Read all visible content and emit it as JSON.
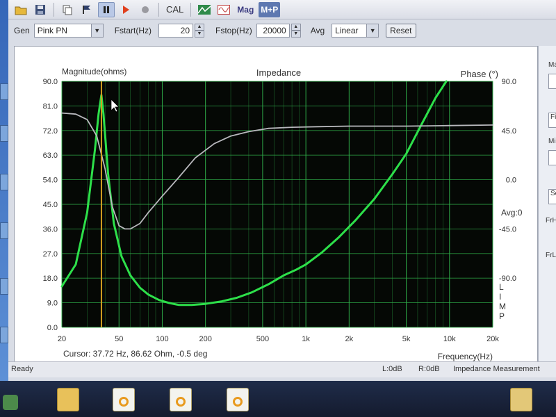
{
  "toolbar": {
    "cal_label": "CAL",
    "mag_label": "Mag",
    "mp_label": "M+P"
  },
  "controls": {
    "gen_label": "Gen",
    "gen_value": "Pink PN",
    "fstart_label": "Fstart(Hz)",
    "fstart_value": "20",
    "fstop_label": "Fstop(Hz)",
    "fstop_value": "20000",
    "avg_label": "Avg",
    "avg_value": "Linear",
    "reset_label": "Reset"
  },
  "right_panel": {
    "ma": "Ma",
    "fi": "Fil",
    "mi": "Min",
    "se": "Set",
    "frhi": "FrHi",
    "frlo": "FrLo"
  },
  "status": {
    "ready": "Ready",
    "left": "L:0dB",
    "right": "R:0dB",
    "mode": "Impedance Measurement"
  },
  "chart_data": {
    "type": "line",
    "title": "Impedance",
    "ylabel": "Magnitude(ohms)",
    "y2label": "Phase (°)",
    "xlabel": "Frequency(Hz)",
    "x_scale": "log",
    "xlim": [
      20,
      20000
    ],
    "ylim": [
      0,
      90
    ],
    "y2lim": [
      -135,
      90
    ],
    "x_tick_labels": [
      "20",
      "50",
      "100",
      "200",
      "500",
      "1k",
      "2k",
      "5k",
      "10k",
      "20k"
    ],
    "x_tick_values": [
      20,
      50,
      100,
      200,
      500,
      1000,
      2000,
      5000,
      10000,
      20000
    ],
    "y_tick_labels": [
      "0.0",
      "9.0",
      "18.0",
      "27.0",
      "36.0",
      "45.0",
      "54.0",
      "63.0",
      "72.0",
      "81.0",
      "90.0"
    ],
    "y2_tick_labels": [
      "90.0",
      "45.0",
      "0.0",
      "-45.0",
      "-90.0"
    ],
    "y2_extra_label": "Avg:0",
    "side_label": [
      "L",
      "I",
      "M",
      "P"
    ],
    "cursor_text": "Cursor: 37.72 Hz, 86.62 Ohm, -0.5 deg",
    "cursor_x": 37.72,
    "colors": {
      "magnitude": "#2de04a",
      "phase": "#b8b8bd",
      "cursor": "#d2a020",
      "grid": "#2fb04a",
      "plot_bg": "#050805"
    },
    "series": [
      {
        "name": "Magnitude",
        "axis": "left",
        "x": [
          20,
          25,
          30,
          34,
          36,
          37.72,
          39,
          42,
          46,
          52,
          60,
          70,
          80,
          95,
          110,
          130,
          160,
          200,
          260,
          330,
          420,
          550,
          700,
          850,
          1000,
          1300,
          1700,
          2200,
          3000,
          4000,
          5000,
          6500,
          8000,
          9500
        ],
        "values": [
          15,
          23,
          42,
          65,
          78,
          85,
          78,
          56,
          38,
          26,
          19,
          14.5,
          12,
          10,
          9,
          8.2,
          8.2,
          8.6,
          9.5,
          10.8,
          12.8,
          15.8,
          19,
          21,
          23,
          27.5,
          33,
          39,
          47,
          56,
          63.5,
          75,
          84,
          90
        ]
      },
      {
        "name": "Phase",
        "axis": "right",
        "x": [
          20,
          25,
          30,
          35,
          40,
          45,
          50,
          55,
          60,
          70,
          80,
          100,
          130,
          170,
          230,
          300,
          400,
          550,
          800,
          1200,
          2000,
          5000,
          10000,
          20000
        ],
        "values": [
          61,
          60,
          55,
          40,
          10,
          -25,
          -42,
          -45,
          -45,
          -40,
          -30,
          -15,
          2,
          20,
          33,
          40,
          44,
          47,
          48,
          48.5,
          49,
          49,
          49.5,
          50
        ]
      }
    ]
  }
}
